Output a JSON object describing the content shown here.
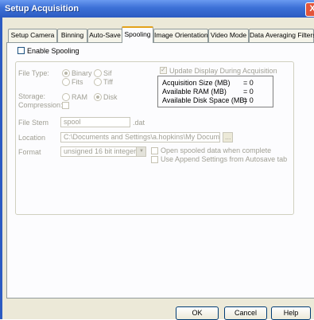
{
  "window": {
    "title": "Setup Acquisition",
    "close_glyph": "X"
  },
  "tabs": [
    {
      "label": "Setup Camera"
    },
    {
      "label": "Binning"
    },
    {
      "label": "Auto-Save"
    },
    {
      "label": "Spooling"
    },
    {
      "label": "Image Orientation"
    },
    {
      "label": "Video Mode"
    },
    {
      "label": "Data Averaging Filters"
    }
  ],
  "spooling": {
    "enable_label": "Enable Spooling",
    "enable_checked": false,
    "file_type_label": "File Type:",
    "file_type_options": [
      {
        "label": "Binary",
        "checked": true
      },
      {
        "label": "Sif",
        "checked": false
      },
      {
        "label": "Fits",
        "checked": false
      },
      {
        "label": "Tiff",
        "checked": false
      }
    ],
    "storage_label": "Storage:",
    "storage_options": [
      {
        "label": "RAM",
        "checked": false
      },
      {
        "label": "Disk",
        "checked": true
      }
    ],
    "compression_label": "Compression:",
    "update_display_label": "Update Display During Acquisition",
    "update_display_checked": true,
    "info": [
      {
        "label": "Acquisition Size (MB)",
        "value": "= 0"
      },
      {
        "label": "Available RAM (MB)",
        "value": "= 0"
      },
      {
        "label": "Available Disk Space (MB)",
        "value": "= 0"
      }
    ],
    "file_stem_label": "File Stem",
    "file_stem_value": "spool",
    "file_ext": ".dat",
    "location_label": "Location",
    "location_value": "C:\\Documents and Settings\\a.hopkins\\My Documents\\",
    "browse_label": "...",
    "format_label": "Format",
    "format_value": "unsigned 16 bit integer",
    "open_spooled_label": "Open spooled data when complete",
    "append_settings_label": "Use Append Settings from Autosave tab"
  },
  "buttons": {
    "ok": "OK",
    "cancel": "Cancel",
    "help": "Help"
  }
}
